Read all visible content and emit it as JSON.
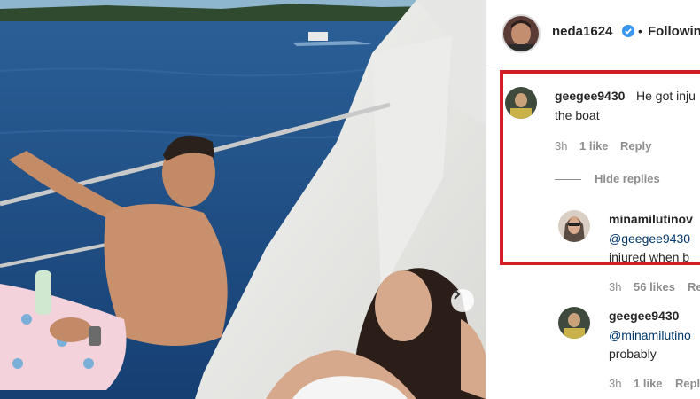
{
  "post": {
    "author": "neda1624",
    "follow_label": "Followin",
    "dot": "•"
  },
  "comments": [
    {
      "user": "geegee9430",
      "text_line1": "He got inju",
      "text_line2": "the boat",
      "time": "3h",
      "likes": "1 like",
      "reply_label": "Reply",
      "hide_replies": "Hide replies"
    },
    {
      "user": "minamilutinov",
      "mention": "@geegee9430",
      "text_line2": "injured when b",
      "time": "3h",
      "likes": "56 likes",
      "reply_label": "Rep"
    },
    {
      "user": "geegee9430",
      "mention": "@minamilutino",
      "text_line2": "probably",
      "time": "3h",
      "likes": "1 like",
      "reply_label": "Repl"
    }
  ],
  "colors": {
    "highlight": "#d21d26",
    "mention": "#00376b",
    "verified": "#3897f0",
    "meta": "#8e8e8e"
  },
  "icons": [
    "verified-badge-icon",
    "chevron-right-icon"
  ]
}
